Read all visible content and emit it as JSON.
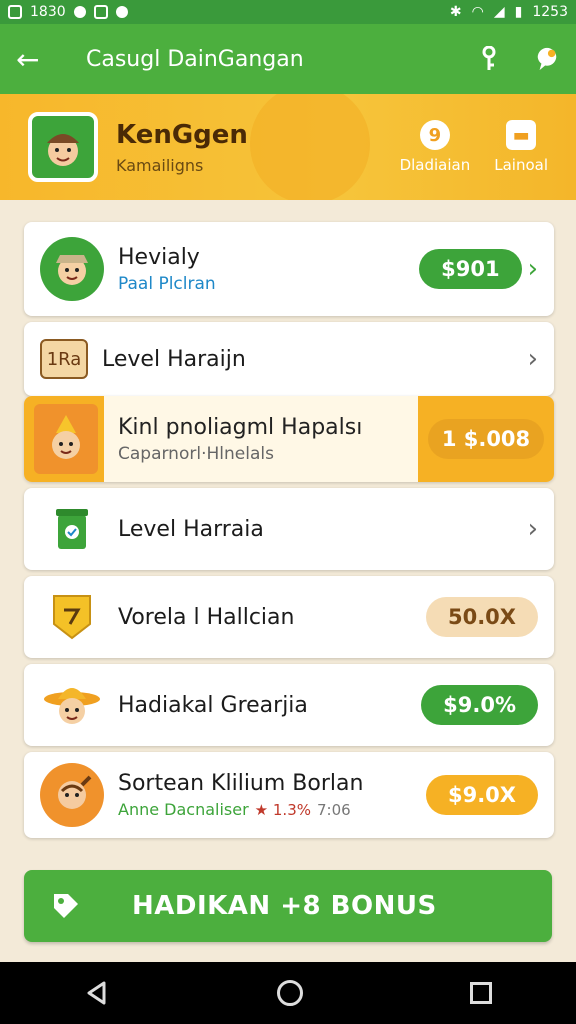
{
  "status": {
    "left_time": "1830",
    "right_time": "1253"
  },
  "appbar": {
    "back_glyph": "←",
    "title": "Casugl DainGangan"
  },
  "profile": {
    "name": "KenGgen",
    "subtitle": "Kamailigns",
    "stats": [
      {
        "value": "9",
        "label": "Dladiaian"
      },
      {
        "value": "",
        "label": "Lainoal"
      }
    ]
  },
  "items": [
    {
      "title": "Hevialy",
      "subtitle": "Paal Plclran",
      "subtitle_color": "#1e88c8",
      "pill": "$901",
      "pill_color": "#3da43a",
      "right_glyph": "›"
    },
    {
      "title": "Level Haraijn",
      "icon_text": "1Ra",
      "right_glyph": "›"
    },
    {
      "title": "Kinl pnoliagml Hapalsı",
      "subtitle": "Caparnorl·Hlnelals",
      "subtitle_color": "#666666",
      "pill": "1 $.008"
    },
    {
      "title": "Level Harraia",
      "right_glyph": "›"
    },
    {
      "title": "Vorela l Hallcian",
      "pill": "50.0X",
      "pill_color": "#f5dcb5",
      "pill_text_color": "#7a4a16"
    },
    {
      "title": "Hadiakal Grearjia",
      "pill": "$9.0%",
      "pill_color": "#3da43a"
    },
    {
      "title": "Sortean Klilium Borlan",
      "subtitle": "Anne Dacnaliser",
      "subtitle_color": "#3da43a",
      "rating": "★ 1.3%",
      "rating_extra": "7:06",
      "pill": "$9.0X",
      "pill_color": "#f6b124"
    }
  ],
  "bonus": {
    "label": "HADIKAN +8 BONUS"
  }
}
